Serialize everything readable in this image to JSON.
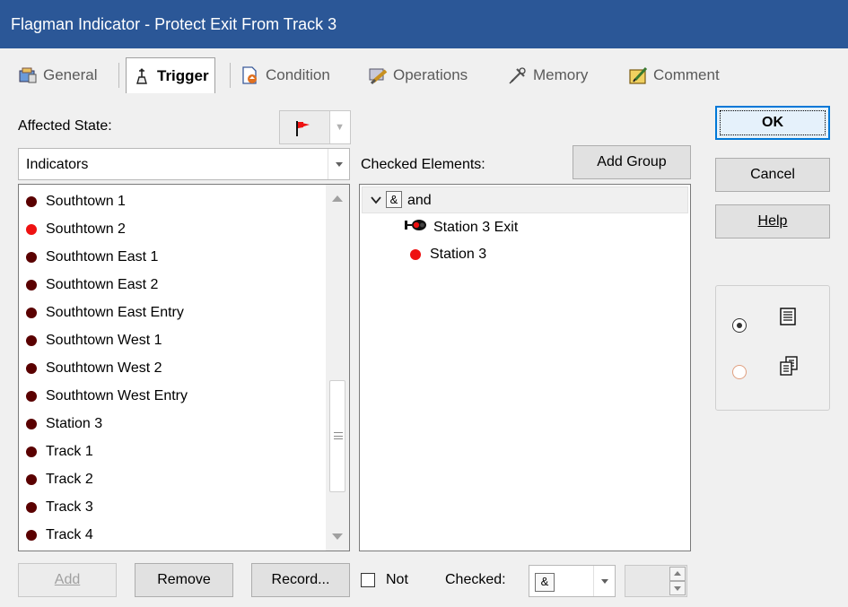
{
  "window": {
    "title": "Flagman Indicator - Protect Exit From Track 3"
  },
  "tabs": [
    {
      "label": "General",
      "icon": "general-properties-icon"
    },
    {
      "label": "Trigger",
      "icon": "trigger-icon",
      "active": true
    },
    {
      "label": "Condition",
      "icon": "condition-icon"
    },
    {
      "label": "Operations",
      "icon": "operations-icon"
    },
    {
      "label": "Memory",
      "icon": "memory-icon"
    },
    {
      "label": "Comment",
      "icon": "comment-icon"
    }
  ],
  "affected_state": {
    "label": "Affected State:",
    "value_icon": "red-flag-icon"
  },
  "element_type": {
    "value": "Indicators"
  },
  "elements_list": {
    "items": [
      {
        "label": "Southtown 1",
        "state": "dark-red"
      },
      {
        "label": "Southtown 2",
        "state": "red"
      },
      {
        "label": "Southtown East 1",
        "state": "dark-red"
      },
      {
        "label": "Southtown East 2",
        "state": "dark-red"
      },
      {
        "label": "Southtown East Entry",
        "state": "dark-red"
      },
      {
        "label": "Southtown West 1",
        "state": "dark-red"
      },
      {
        "label": "Southtown West 2",
        "state": "dark-red"
      },
      {
        "label": "Southtown West Entry",
        "state": "dark-red"
      },
      {
        "label": "Station 3",
        "state": "dark-red"
      },
      {
        "label": "Track 1",
        "state": "dark-red"
      },
      {
        "label": "Track 2",
        "state": "dark-red"
      },
      {
        "label": "Track 3",
        "state": "dark-red"
      },
      {
        "label": "Track 4",
        "state": "dark-red"
      }
    ]
  },
  "checked_elements": {
    "label": "Checked Elements:",
    "add_group_label": "Add Group",
    "root": {
      "operator": "&",
      "label": "and"
    },
    "children": [
      {
        "label": "Station 3 Exit",
        "icon": "signal-icon"
      },
      {
        "label": "Station 3",
        "icon": "red-indicator-icon"
      }
    ]
  },
  "dialog_buttons": {
    "ok": "OK",
    "cancel": "Cancel",
    "help": "Help"
  },
  "bottom": {
    "add": "Add",
    "remove": "Remove",
    "record": "Record...",
    "not_label": "Not",
    "checked_label": "Checked:",
    "checked_value": "&"
  },
  "colors": {
    "titlebar": "#2b5797",
    "default_button_border": "#0078d7",
    "indicator_red": "#ee1111",
    "indicator_dark": "#5a0000"
  }
}
